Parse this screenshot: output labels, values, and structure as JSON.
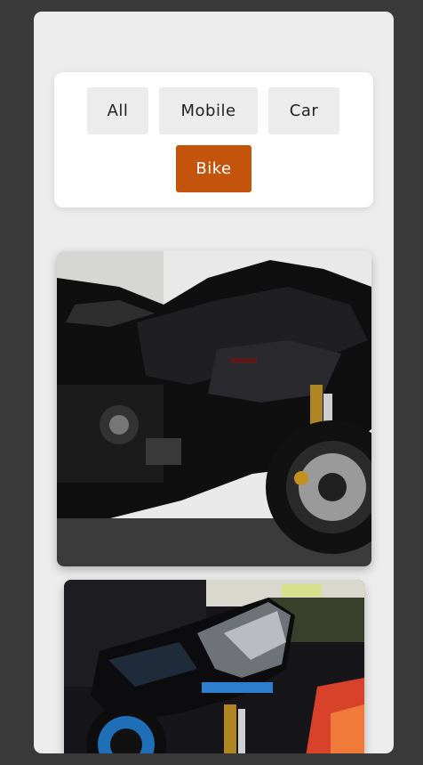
{
  "filters": [
    {
      "label": "All",
      "active": false
    },
    {
      "label": "Mobile",
      "active": false
    },
    {
      "label": "Car",
      "active": false
    },
    {
      "label": "Bike",
      "active": true
    }
  ],
  "colors": {
    "page_bg": "#3a3a3a",
    "panel_bg": "#ececec",
    "active_filter": "#c4540b"
  },
  "gallery": {
    "items": [
      {
        "subject": "black sport motorcycle"
      },
      {
        "subject": "black and blue sport motorcycle at night"
      }
    ]
  }
}
